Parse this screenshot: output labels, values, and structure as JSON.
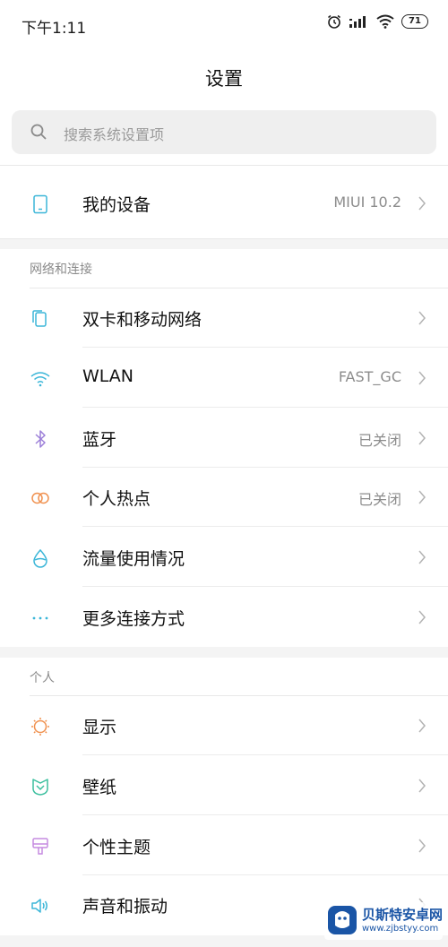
{
  "status_bar": {
    "time": "下午1:11",
    "battery": "71"
  },
  "header": {
    "title": "设置"
  },
  "search": {
    "placeholder": "搜索系统设置项"
  },
  "device": {
    "label": "我的设备",
    "value": "MIUI 10.2"
  },
  "sections": {
    "network": {
      "header": "网络和连接",
      "items": [
        {
          "label": "双卡和移动网络",
          "value": "",
          "icon": "sim-card-icon",
          "color": "#3bb6d8"
        },
        {
          "label": "WLAN",
          "value": "FAST_GC",
          "icon": "wifi-icon",
          "color": "#3bb6d8"
        },
        {
          "label": "蓝牙",
          "value": "已关闭",
          "icon": "bluetooth-icon",
          "color": "#9b7ed8"
        },
        {
          "label": "个人热点",
          "value": "已关闭",
          "icon": "hotspot-icon",
          "color": "#f0914f"
        },
        {
          "label": "流量使用情况",
          "value": "",
          "icon": "data-usage-icon",
          "color": "#3bb6d8"
        },
        {
          "label": "更多连接方式",
          "value": "",
          "icon": "more-dots-icon",
          "color": "#3bb6d8"
        }
      ]
    },
    "personal": {
      "header": "个人",
      "items": [
        {
          "label": "显示",
          "value": "",
          "icon": "sun-icon",
          "color": "#f0914f"
        },
        {
          "label": "壁纸",
          "value": "",
          "icon": "wallpaper-icon",
          "color": "#3bbf9e"
        },
        {
          "label": "个性主题",
          "value": "",
          "icon": "theme-brush-icon",
          "color": "#c58be0"
        },
        {
          "label": "声音和振动",
          "value": "",
          "icon": "speaker-icon",
          "color": "#3bb6d8"
        }
      ]
    }
  },
  "watermark": {
    "title": "贝斯特安卓网",
    "url": "www.zjbstyy.com"
  }
}
